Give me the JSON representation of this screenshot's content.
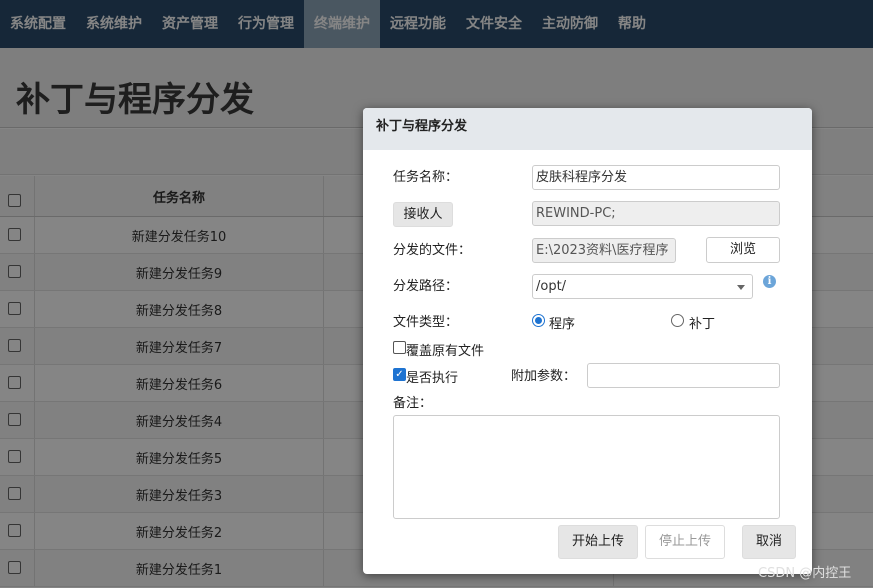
{
  "nav": {
    "items": [
      "系统配置",
      "系统维护",
      "资产管理",
      "行为管理",
      "终端维护",
      "远程功能",
      "文件安全",
      "主动防御",
      "帮助"
    ]
  },
  "page": {
    "title": "补丁与程序分发"
  },
  "table": {
    "header_name": "任务名称",
    "rows": [
      "新建分发任务10",
      "新建分发任务9",
      "新建分发任务8",
      "新建分发任务7",
      "新建分发任务6",
      "新建分发任务4",
      "新建分发任务5",
      "新建分发任务3",
      "新建分发任务2",
      "新建分发任务1"
    ]
  },
  "dialog": {
    "title": "补丁与程序分发",
    "task_name_label": "任务名称：",
    "task_name_value": "皮肤科程序分发",
    "receiver_button": "接收人",
    "receiver_value": "REWIND-PC;",
    "file_label": "分发的文件：",
    "file_value": "E:\\2023资料\\医疗程序",
    "browse_button": "浏览",
    "path_label": "分发路径：",
    "path_value": "/opt/",
    "info_icon": "i",
    "file_type_label": "文件类型：",
    "type_program": "程序",
    "type_patch": "补丁",
    "overwrite_label": "覆盖原有文件",
    "execute_label": "是否执行",
    "extra_params_label": "附加参数：",
    "extra_params_value": "",
    "notes_label": "备注：",
    "start_button": "开始上传",
    "stop_button": "停止上传",
    "cancel_button": "取消"
  },
  "watermark": "CSDN @内控王",
  "colors": {
    "nav_bg": "#2b4c6b",
    "nav_active": "#8fa7bb",
    "accent": "#1e73d1"
  }
}
